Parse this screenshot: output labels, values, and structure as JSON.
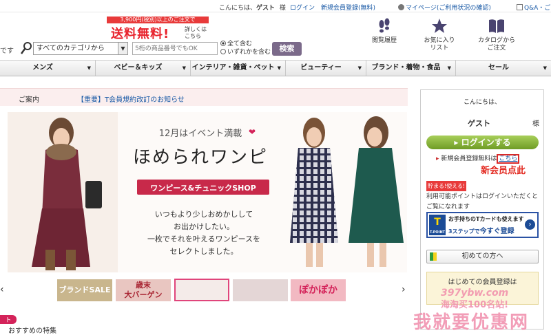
{
  "topbar": {
    "greeting_prefix": "こんにちは、",
    "greeting_name": "ゲスト",
    "greeting_suffix": "様",
    "login": "ログイン",
    "register": "新規会員登録(無料)",
    "mypage": "マイページ(ご利用状況の確認)",
    "qa": "Q&A・ご"
  },
  "header": {
    "left_fragment": "です",
    "promo_top": "3,900円(税別)以上のご注文で",
    "promo_big": "送料無料!",
    "promo_detail": "詳しくは こちら",
    "category_select": "すべてのカテゴリから",
    "keyword_placeholder": "5桁の商品番号でもOK",
    "radio_all": "全て含む",
    "radio_any": "いずれかを含む",
    "search_button": "検索",
    "history": "閲覧履歴",
    "favorites_line1": "お気に入り",
    "favorites_line2": "リスト",
    "catalog_line1": "カタログから",
    "catalog_line2": "ご注文"
  },
  "nav": [
    "メンズ",
    "ベビー＆キッズ",
    "インテリア・雑貨・ペット",
    "ビューティー",
    "ブランド・着物・食品",
    "セール"
  ],
  "notice": {
    "label": "ご案内",
    "link": "【重要】T会員規約改訂のお知らせ"
  },
  "banner": {
    "event": "12月はイベント満載",
    "title": "ほめられワンピ",
    "shop": "ワンピース&チュニックSHOP",
    "body": [
      "いつもより少しおめかしして",
      "お出かけしたい。",
      "一枚でそれを叶えるワンピースを",
      "セレクトしました。"
    ]
  },
  "carousel": {
    "brand_sale": "ブランドSALE",
    "year_end_1": "歳末",
    "year_end_2": "大バーゲン",
    "pokapoka": "ぽかぽか"
  },
  "bottom_fragment": "おすすめの特集",
  "bottom_badge": "ト",
  "sidebar": {
    "hello": "こんにちは、",
    "guest": "ゲスト",
    "sama": "様",
    "login_button": "ログインする",
    "register_text": "新規会員登録無料は",
    "register_link": "こちら",
    "annotation": "新会员点此",
    "points_badge": "貯まる!使える!",
    "points_text": "利用可能ポイントはログインいただくとご覧になれます",
    "tcard_line1": "お手持ちのTカードも使えます",
    "tcard_line2_a": "3ステップで",
    "tcard_line2_b": "今すぐ登録",
    "tcard_logo": "T",
    "tcard_logo_sub": "T-POINT",
    "first_time": "初めての方へ",
    "member_line1": "はじめての会員登録は"
  },
  "watermark": {
    "line1": "397ybw.com",
    "line2": "海淘买100名站!",
    "line3": "我就要优惠网"
  },
  "colors": {
    "accent_red": "#e8222c",
    "login_green": "#7fae2e",
    "search_purple": "#7b6a8a",
    "tpoint_blue": "#1b4b96"
  }
}
